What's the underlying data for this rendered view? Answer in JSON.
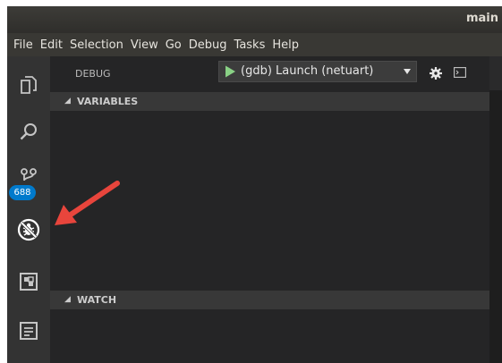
{
  "window": {
    "title": "main"
  },
  "menubar": {
    "items": [
      "File",
      "Edit",
      "Selection",
      "View",
      "Go",
      "Debug",
      "Tasks",
      "Help"
    ]
  },
  "activity_bar": {
    "icons": [
      "explorer-icon",
      "search-icon",
      "source-control-icon",
      "debug-icon",
      "extensions-icon",
      "terminal-panel-icon"
    ],
    "scm_badge": "688"
  },
  "debug": {
    "title": "DEBUG",
    "config_selected": "(gdb) Launch (netuart)",
    "sections": {
      "variables": "VARIABLES",
      "watch": "WATCH"
    }
  },
  "colors": {
    "activity_bar": "#333333",
    "sidebar": "#252526",
    "section_header": "#383838",
    "badge": "#007acc",
    "run_green": "#89d185",
    "annotation_arrow": "#e8453c"
  }
}
